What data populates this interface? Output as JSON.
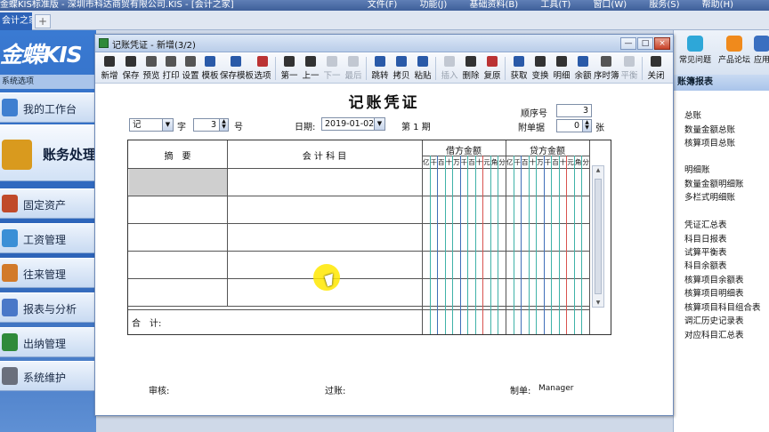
{
  "app": {
    "title": "金蝶KIS标准版 - 深圳市科达商贸有限公司.KIS - [会计之家]",
    "menus": [
      "文件(F)",
      "功能(J)",
      "基础资料(B)",
      "工具(T)",
      "窗口(W)",
      "服务(S)",
      "帮助(H)"
    ]
  },
  "tabs": {
    "active": "会计之家",
    "add": "+"
  },
  "leftnav": {
    "logo": "金蝶KIS",
    "header": "系统选项",
    "items": [
      {
        "label": "我的工作台",
        "icon": "monitor-icon",
        "color": "#3f7fd0"
      },
      {
        "label": "账务处理",
        "icon": "calculator-icon",
        "color": "#d99a1e"
      },
      {
        "label": "固定资产",
        "icon": "building-icon",
        "color": "#c04a2a"
      },
      {
        "label": "工资管理",
        "icon": "people-icon",
        "color": "#3b8fd6"
      },
      {
        "label": "往来管理",
        "icon": "handshake-icon",
        "color": "#d27a2a"
      },
      {
        "label": "报表与分析",
        "icon": "report-icon",
        "color": "#4a78c8"
      },
      {
        "label": "出纳管理",
        "icon": "cash-icon",
        "color": "#2f8a3a"
      },
      {
        "label": "系统维护",
        "icon": "wrench-icon",
        "color": "#6a6f7c"
      }
    ]
  },
  "rightpanel": {
    "quick": [
      {
        "label": "常见问题",
        "icon": "help-icon",
        "color": "#2ea7d8"
      },
      {
        "label": "产品论坛",
        "icon": "forum-icon",
        "color": "#f08a1c"
      },
      {
        "label": "应用",
        "icon": "app-icon",
        "color": "#3a6fc0"
      }
    ],
    "section_title": "账簿报表",
    "links": [
      "总账",
      "数量金额总账",
      "核算项目总账",
      "明细账",
      "数量金额明细账",
      "多栏式明细账",
      "凭证汇总表",
      "科目日报表",
      "试算平衡表",
      "科目余额表",
      "核算项目余额表",
      "核算项目明细表",
      "核算项目科目组合表",
      "调汇历史记录表",
      "对应科目汇总表"
    ]
  },
  "dialog": {
    "title": "记账凭证 - 新增(3/2)",
    "toolbar": [
      {
        "label": "新增",
        "icon": "new-doc-icon",
        "enabled": true
      },
      {
        "label": "保存",
        "icon": "save-icon",
        "enabled": true
      },
      {
        "label": "预览",
        "icon": "preview-icon",
        "enabled": true
      },
      {
        "label": "打印",
        "icon": "print-icon",
        "enabled": true
      },
      {
        "label": "设置",
        "icon": "settings-icon",
        "enabled": true
      },
      {
        "label": "模板",
        "icon": "template-icon",
        "enabled": true
      },
      {
        "label": "保存模板",
        "icon": "save-template-icon",
        "enabled": true
      },
      {
        "label": "选项",
        "icon": "options-icon",
        "enabled": true
      },
      {
        "label": "第一",
        "icon": "first-icon",
        "enabled": true
      },
      {
        "label": "上一",
        "icon": "prev-icon",
        "enabled": true
      },
      {
        "label": "下一",
        "icon": "next-icon",
        "enabled": false
      },
      {
        "label": "最后",
        "icon": "last-icon",
        "enabled": false
      },
      {
        "label": "跳转",
        "icon": "jump-icon",
        "enabled": true
      },
      {
        "label": "拷贝",
        "icon": "copy-icon",
        "enabled": true
      },
      {
        "label": "粘贴",
        "icon": "paste-icon",
        "enabled": true
      },
      {
        "label": "插入",
        "icon": "insert-icon",
        "enabled": false
      },
      {
        "label": "删除",
        "icon": "delete-icon",
        "enabled": true
      },
      {
        "label": "复原",
        "icon": "restore-icon",
        "enabled": true
      },
      {
        "label": "获取",
        "icon": "fetch-icon",
        "enabled": true
      },
      {
        "label": "变换",
        "icon": "switch-icon",
        "enabled": true
      },
      {
        "label": "明细",
        "icon": "detail-icon",
        "enabled": true
      },
      {
        "label": "余额",
        "icon": "balance-icon",
        "enabled": true
      },
      {
        "label": "序时簿",
        "icon": "journal-icon",
        "enabled": true
      },
      {
        "label": "平衡",
        "icon": "equal-icon",
        "enabled": false
      },
      {
        "label": "关闭",
        "icon": "exit-icon",
        "enabled": true
      }
    ],
    "window_buttons": {
      "minimize": "—",
      "maximize": "□",
      "close": "×"
    }
  },
  "voucher": {
    "title": "记账凭证",
    "word_value": "记",
    "word_label": "字",
    "number_value": "3",
    "number_label": "号",
    "date_label": "日期:",
    "date_value": "2019-01-02",
    "period": "第 1 期",
    "seq_label": "顺序号",
    "seq_value": "3",
    "attach_label": "附单据",
    "attach_value": "0",
    "attach_unit": "张",
    "col_summary": "摘　要",
    "col_account": "会 计 科 目",
    "col_debit": "借方金额",
    "col_credit": "贷方金额",
    "digits": [
      "亿",
      "千",
      "百",
      "十",
      "万",
      "千",
      "百",
      "十",
      "元",
      "角",
      "分"
    ],
    "total_label": "合　计:",
    "reviewer_label": "审核:",
    "poster_label": "过账:",
    "maker_label": "制单:",
    "maker_value": "Manager"
  }
}
